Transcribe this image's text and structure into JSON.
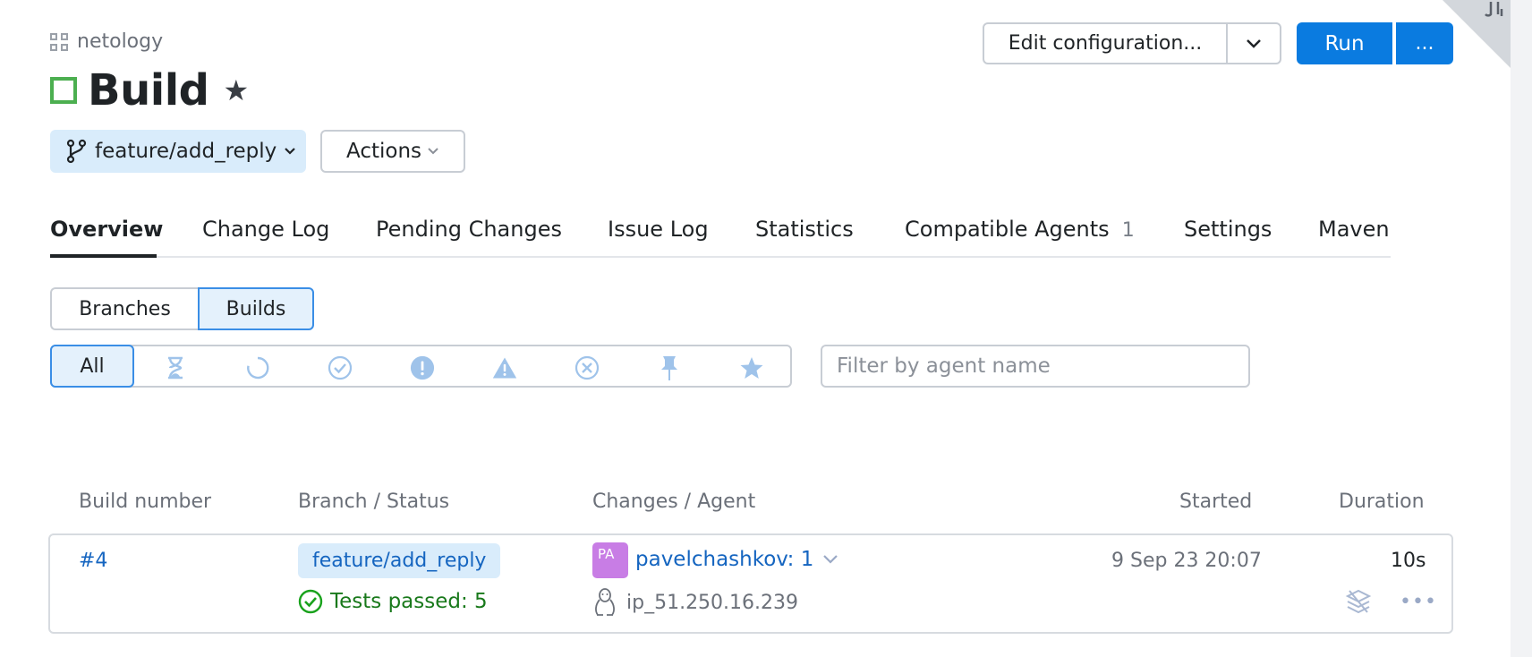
{
  "header": {
    "project": "netology",
    "title": "Build",
    "edit_config_label": "Edit configuration...",
    "run_label": "Run",
    "more_label": "..."
  },
  "branch": {
    "label": "feature/add_reply",
    "actions_label": "Actions"
  },
  "tabs": [
    {
      "label": "Overview",
      "active": true
    },
    {
      "label": "Change Log"
    },
    {
      "label": "Pending Changes"
    },
    {
      "label": "Issue Log"
    },
    {
      "label": "Statistics"
    },
    {
      "label": "Compatible Agents",
      "count": "1"
    },
    {
      "label": "Settings"
    },
    {
      "label": "Maven"
    }
  ],
  "view_toggle": {
    "branches_label": "Branches",
    "builds_label": "Builds",
    "selected": "Builds"
  },
  "filters": {
    "all_label": "All",
    "icons": [
      "hourglass-icon",
      "running-icon",
      "success-icon",
      "failed-icon",
      "warning-icon",
      "canceled-icon",
      "pin-icon",
      "star-icon"
    ],
    "agent_placeholder": "Filter by agent name"
  },
  "table": {
    "headers": {
      "build_number": "Build number",
      "branch_status": "Branch / Status",
      "changes_agent": "Changes / Agent",
      "started": "Started",
      "duration": "Duration"
    },
    "rows": [
      {
        "number": "#4",
        "branch": "feature/add_reply",
        "status": "Tests passed: 5",
        "avatar_initials": "PA",
        "changes": "pavelchashkov: 1",
        "agent": "ip_51.250.16.239",
        "started": "9 Sep 23 20:07",
        "duration": "10s"
      }
    ]
  },
  "colors": {
    "primary": "#0a7be0",
    "success": "#4caf50",
    "link": "#1565c0",
    "avatar": "#c87de5"
  }
}
